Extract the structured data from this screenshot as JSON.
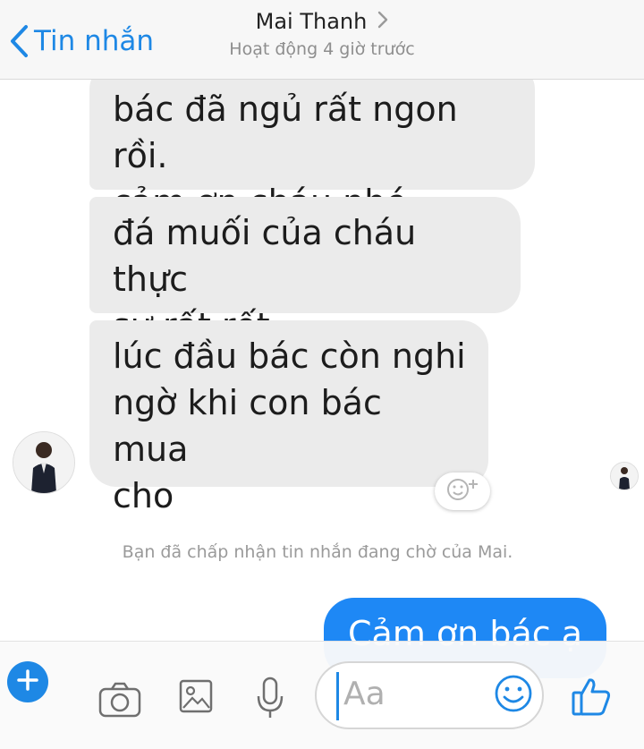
{
  "header": {
    "back_label": "Tin nhắn",
    "contact_name": "Mai Thanh",
    "status": "Hoạt động 4 giờ trước"
  },
  "messages": [
    {
      "direction": "incoming",
      "text": "bác đã ngủ rất ngon rồi.\ncảm ơn cháu nhé."
    },
    {
      "direction": "incoming",
      "text": "đá muối của cháu thực\nsự rất rốt."
    },
    {
      "direction": "incoming",
      "text": "lúc đầu bác còn nghi\nngờ khi con bác mua\ncho"
    },
    {
      "direction": "outgoing",
      "text": "Cảm ơn bác ạ"
    }
  ],
  "notice": "Bạn đã chấp nhận tin nhắn đang chờ của Mai.",
  "composer": {
    "placeholder": "Aa"
  },
  "colors": {
    "accent": "#1e88e5",
    "incoming_bubble": "#ebebeb",
    "outgoing_bubble": "#1e88f5"
  },
  "icons": [
    "chevron-left-icon",
    "chevron-right-icon",
    "add-reaction-icon",
    "plus-icon",
    "camera-icon",
    "image-icon",
    "microphone-icon",
    "emoji-icon",
    "thumbs-up-icon"
  ]
}
